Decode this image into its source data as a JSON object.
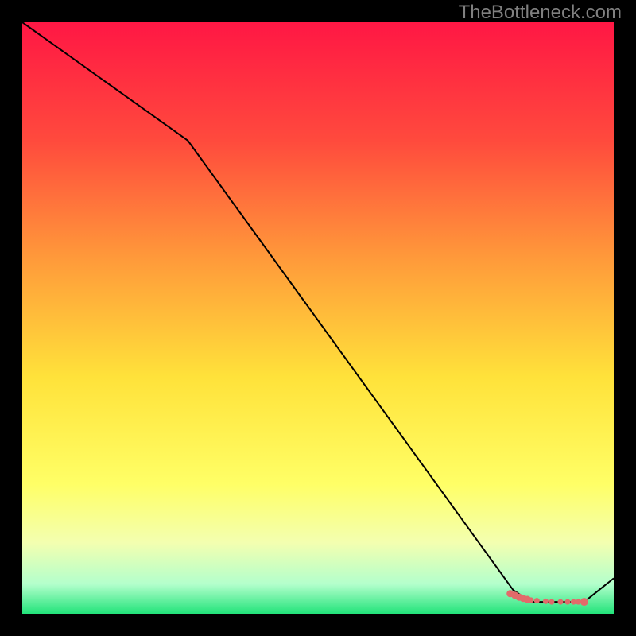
{
  "watermark": "TheBottleneck.com",
  "chart_data": {
    "type": "line",
    "title": "",
    "xlabel": "",
    "ylabel": "",
    "xlim": [
      0,
      100
    ],
    "ylim": [
      0,
      100
    ],
    "gradient_stops": [
      {
        "offset": 0,
        "color": "#ff1744"
      },
      {
        "offset": 20,
        "color": "#ff4a3d"
      },
      {
        "offset": 40,
        "color": "#ff9a3a"
      },
      {
        "offset": 60,
        "color": "#ffe23a"
      },
      {
        "offset": 78,
        "color": "#ffff66"
      },
      {
        "offset": 88,
        "color": "#f3ffb0"
      },
      {
        "offset": 95,
        "color": "#b3ffcc"
      },
      {
        "offset": 100,
        "color": "#22e37a"
      }
    ],
    "series": [
      {
        "name": "curve",
        "type": "line",
        "x": [
          0,
          28,
          83,
          86,
          95,
          100
        ],
        "y": [
          100,
          80,
          4,
          2,
          2,
          6
        ]
      },
      {
        "name": "markers",
        "type": "scatter",
        "points": [
          {
            "x": 82.5,
            "y": 3.4,
            "r": 2.9
          },
          {
            "x": 83.3,
            "y": 3.1,
            "r": 2.9
          },
          {
            "x": 84.0,
            "y": 2.8,
            "r": 2.9
          },
          {
            "x": 84.7,
            "y": 2.6,
            "r": 2.9
          },
          {
            "x": 85.4,
            "y": 2.4,
            "r": 2.9
          },
          {
            "x": 86.0,
            "y": 2.3,
            "r": 2.2
          },
          {
            "x": 87.0,
            "y": 2.2,
            "r": 2.2
          },
          {
            "x": 88.5,
            "y": 2.1,
            "r": 2.2
          },
          {
            "x": 89.5,
            "y": 2.0,
            "r": 2.2
          },
          {
            "x": 91.0,
            "y": 2.0,
            "r": 2.2
          },
          {
            "x": 92.2,
            "y": 2.0,
            "r": 2.2
          },
          {
            "x": 93.2,
            "y": 2.0,
            "r": 2.2
          },
          {
            "x": 94.0,
            "y": 2.0,
            "r": 2.2
          },
          {
            "x": 95.0,
            "y": 2.0,
            "r": 3.1
          }
        ]
      }
    ],
    "colors": {
      "line": "#000000",
      "marker": "#e26a6a"
    }
  }
}
